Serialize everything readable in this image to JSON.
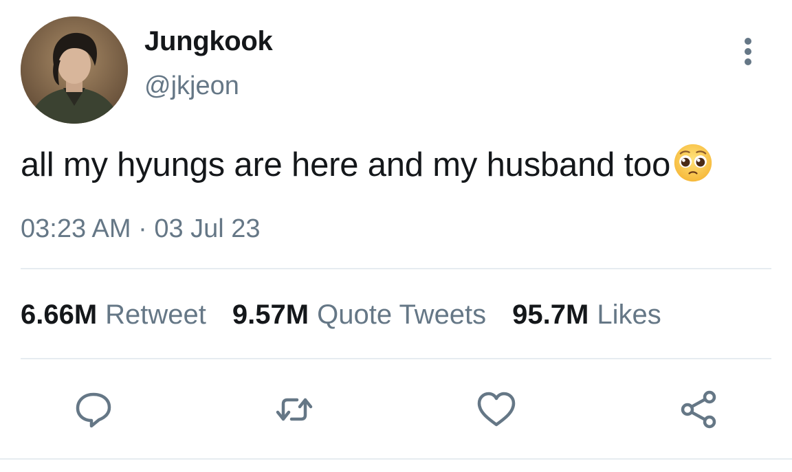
{
  "user": {
    "display_name": "Jungkook",
    "handle": "@jkjeon",
    "avatar_icon": "profile-photo"
  },
  "tweet": {
    "text": "all my hyungs are here and my husband too",
    "emoji": "pleading-face-emoji",
    "timestamp": "03:23 AM · 03 Jul 23"
  },
  "stats": {
    "retweets_count": "6.66M",
    "retweets_label": "Retweet",
    "quotes_count": "9.57M",
    "quotes_label": "Quote Tweets",
    "likes_count": "95.7M",
    "likes_label": "Likes"
  },
  "actions": {
    "reply_icon": "reply-icon",
    "retweet_icon": "retweet-icon",
    "like_icon": "heart-icon",
    "share_icon": "share-icon",
    "more_icon": "more-vertical-icon"
  },
  "colors": {
    "text_primary": "#14171a",
    "text_secondary": "#657786",
    "divider": "#e6ecf0",
    "icon": "#657786"
  }
}
